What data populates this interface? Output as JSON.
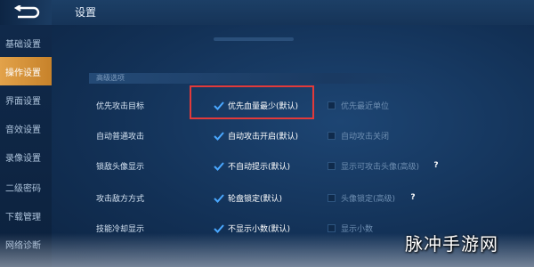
{
  "header": {
    "title": "设置"
  },
  "sidebar": {
    "items": [
      {
        "label": "基础设置",
        "active": false
      },
      {
        "label": "操作设置",
        "active": true
      },
      {
        "label": "界面设置",
        "active": false
      },
      {
        "label": "音效设置",
        "active": false
      },
      {
        "label": "录像设置",
        "active": false
      },
      {
        "label": "二级密码",
        "active": false
      },
      {
        "label": "下载管理",
        "active": false
      },
      {
        "label": "网络诊断",
        "active": false
      }
    ]
  },
  "section": {
    "title": "高级选项"
  },
  "rows": [
    {
      "label": "优先攻击目标",
      "opt1": "优先血量最少(默认)",
      "opt1_checked": true,
      "opt2": "优先最近单位",
      "opt2_checked": false,
      "help": false
    },
    {
      "label": "自动普通攻击",
      "opt1": "自动攻击开启(默认)",
      "opt1_checked": true,
      "opt2": "自动攻击关闭",
      "opt2_checked": false,
      "help": false
    },
    {
      "label": "锁敌头像显示",
      "opt1": "不自动提示(默认)",
      "opt1_checked": true,
      "opt2": "显示可攻击头像(高级)",
      "opt2_checked": false,
      "help": true
    },
    {
      "label": "攻击敌方方式",
      "opt1": "轮盘锁定(默认)",
      "opt1_checked": true,
      "opt2": "头像锁定(高级)",
      "opt2_checked": false,
      "help": true
    },
    {
      "label": "技能冷却显示",
      "opt1": "不显示小数(默认)",
      "opt1_checked": true,
      "opt2": "显示小数",
      "opt2_checked": false,
      "help": false
    }
  ],
  "help_glyph": "?",
  "watermark": "脉冲手游网",
  "colors": {
    "accent": "#e2a24a",
    "check": "#4aa8ff",
    "highlight": "#e23a3a"
  },
  "icons": {
    "back": "back-arrow-icon",
    "check": "checkmark-icon",
    "help": "help-icon"
  }
}
